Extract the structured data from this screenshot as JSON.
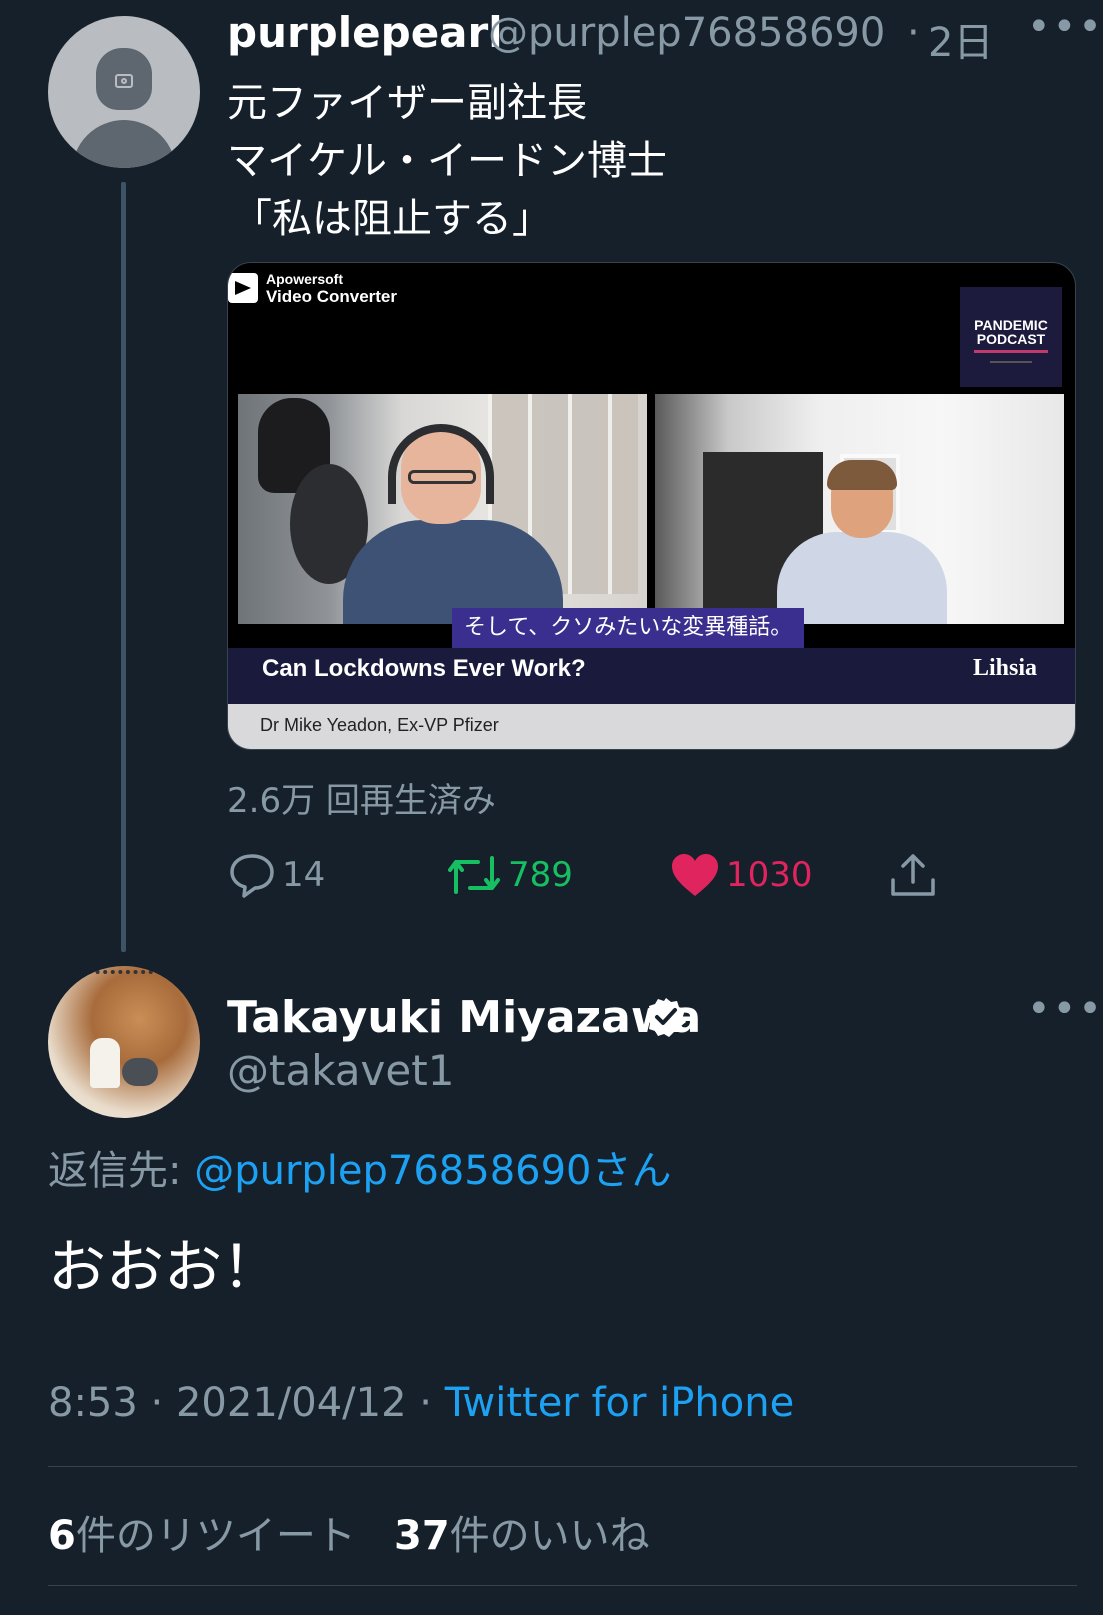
{
  "tweet1": {
    "name": "purplepearl",
    "handle": "@purplep76858690",
    "separator": "·",
    "time": "2日",
    "text_lines": [
      "元ファイザー副社長",
      "マイケル・イードン博士",
      "「私は阻止する」"
    ],
    "video": {
      "converter_line1": "Apowersoft",
      "converter_line2": "Video Converter",
      "podcast_line1": "PANDEMIC",
      "podcast_line2": "PODCAST",
      "subtitle": "そして、クソみたいな変異種話。",
      "banner_title": "Can Lockdowns Ever Work?",
      "banner_right": "Lihsia",
      "lower_third": "Dr Mike Yeadon, Ex-VP Pfizer"
    },
    "views": "2.6万 回再生済み",
    "actions": {
      "reply_count": "14",
      "retweet_count": "789",
      "like_count": "1030"
    }
  },
  "tweet2": {
    "name": "Takayuki Miyazawa",
    "handle": "@takavet1",
    "reply_to_label": "返信先: ",
    "reply_to_user": "@purplep76858690さん",
    "text": "おおお！",
    "time": "8:53",
    "date": "2021/04/12",
    "separator": "·",
    "client": "Twitter for iPhone",
    "retweet_count": "6",
    "retweet_label": "件のリツイート",
    "like_count": "37",
    "like_label": "件のいいね"
  },
  "more_glyph": "•••",
  "colors": {
    "background": "#15202b",
    "muted": "#8899a6",
    "link": "#1da1f2",
    "retweet": "#17bf63",
    "like": "#e0245e"
  },
  "icons": [
    "camera-icon",
    "more-icon",
    "reply-icon",
    "retweet-icon",
    "heart-icon",
    "share-icon",
    "verified-icon"
  ]
}
